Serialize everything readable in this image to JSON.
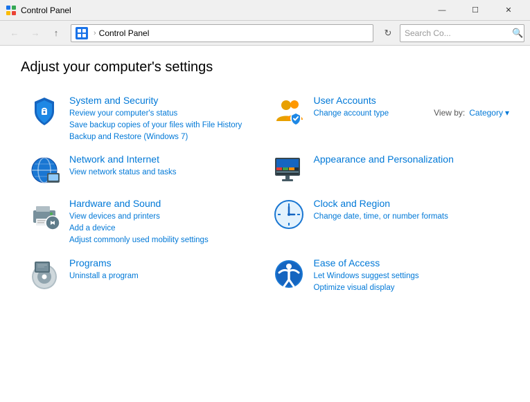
{
  "titleBar": {
    "icon": "control-panel-icon",
    "title": "Control Panel",
    "minimizeLabel": "—",
    "maximizeLabel": "☐",
    "closeLabel": "✕"
  },
  "navBar": {
    "backLabel": "←",
    "forwardLabel": "→",
    "upLabel": "↑",
    "addressIconLabel": "CP",
    "addressSeparator": "›",
    "addressRoot": "Control Panel",
    "refreshLabel": "↻",
    "searchPlaceholder": "Search Co...",
    "searchIconLabel": "🔍"
  },
  "header": {
    "pageTitle": "Adjust your computer's settings",
    "viewByLabel": "View by:",
    "viewByValue": "Category",
    "viewByChevron": "▾"
  },
  "categories": [
    {
      "id": "system-security",
      "title": "System and Security",
      "links": [
        "Review your computer's status",
        "Save backup copies of your files with File History",
        "Backup and Restore (Windows 7)"
      ]
    },
    {
      "id": "user-accounts",
      "title": "User Accounts",
      "links": [
        "Change account type"
      ]
    },
    {
      "id": "network-internet",
      "title": "Network and Internet",
      "links": [
        "View network status and tasks"
      ]
    },
    {
      "id": "appearance-personalization",
      "title": "Appearance and Personalization",
      "links": []
    },
    {
      "id": "hardware-sound",
      "title": "Hardware and Sound",
      "links": [
        "View devices and printers",
        "Add a device",
        "Adjust commonly used mobility settings"
      ]
    },
    {
      "id": "clock-region",
      "title": "Clock and Region",
      "links": [
        "Change date, time, or number formats"
      ]
    },
    {
      "id": "programs",
      "title": "Programs",
      "links": [
        "Uninstall a program"
      ]
    },
    {
      "id": "ease-of-access",
      "title": "Ease of Access",
      "links": [
        "Let Windows suggest settings",
        "Optimize visual display"
      ]
    }
  ]
}
